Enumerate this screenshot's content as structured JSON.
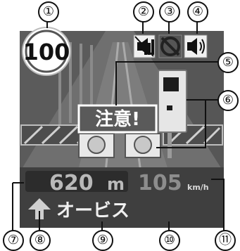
{
  "screen": {
    "speed_limit": "100",
    "caution_label": "注意!",
    "distance_value": "620",
    "distance_unit": "m",
    "speed_value": "105",
    "speed_unit": "km/h",
    "alert_label": "オービス"
  },
  "icons": {
    "mute": "speaker-muted-icon",
    "signal": "signal-bars-icon",
    "gps": "gps-off-icon",
    "volume": "speaker-volume-icon",
    "direction": "arrow-up-icon"
  },
  "callouts": [
    "①",
    "②",
    "③",
    "④",
    "⑤",
    "⑥",
    "⑦",
    "⑧",
    "⑨",
    "⑩",
    "⑪"
  ],
  "colors": {
    "screen_bg": "#3c3c3c",
    "panel_bg": "#4a4a4a",
    "digit": "#b9b9b9",
    "caution_bg": "#5a5a5a",
    "accent": "#ffffff"
  }
}
